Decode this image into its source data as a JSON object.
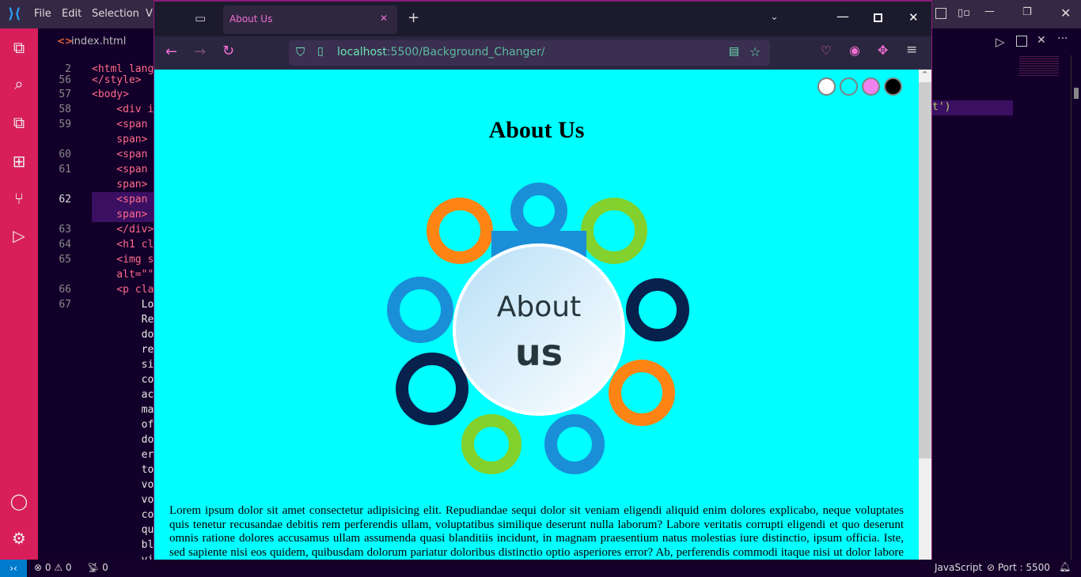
{
  "vscode": {
    "menu": [
      "File",
      "Edit",
      "Selection",
      "V"
    ],
    "tab": "index.html",
    "code_lines": [
      {
        "n": "2",
        "t": "<html lang"
      },
      {
        "n": "56",
        "t": "</style>"
      },
      {
        "n": "57",
        "t": "<body>"
      },
      {
        "n": "58",
        "t": "    <div i"
      },
      {
        "n": "59",
        "t": "    <span "
      },
      {
        "n": "",
        "t": "    span>"
      },
      {
        "n": "60",
        "t": "    <span "
      },
      {
        "n": "61",
        "t": "    <span "
      },
      {
        "n": "",
        "t": "    span>"
      },
      {
        "n": "62",
        "t": "    <span "
      },
      {
        "n": "",
        "t": "    span>"
      },
      {
        "n": "63",
        "t": "    </div>"
      },
      {
        "n": "64",
        "t": "    <h1 cl"
      },
      {
        "n": "65",
        "t": "    <img s"
      },
      {
        "n": "",
        "t": "    alt=\"\""
      },
      {
        "n": "66",
        "t": "    <p cla"
      },
      {
        "n": "67",
        "t": "        Lo"
      },
      {
        "n": "",
        "t": "        Re"
      },
      {
        "n": "",
        "t": "        do"
      },
      {
        "n": "",
        "t": "        re"
      },
      {
        "n": "",
        "t": "        si"
      },
      {
        "n": "",
        "t": "        co"
      },
      {
        "n": "",
        "t": "        ac"
      },
      {
        "n": "",
        "t": "        ma"
      },
      {
        "n": "",
        "t": "        of"
      },
      {
        "n": "",
        "t": "        do"
      },
      {
        "n": "",
        "t": "        er"
      },
      {
        "n": "",
        "t": "        to"
      },
      {
        "n": "",
        "t": "        vo"
      },
      {
        "n": "",
        "t": "        vo"
      },
      {
        "n": "",
        "t": "        co"
      },
      {
        "n": "",
        "t": "        qu"
      },
      {
        "n": "",
        "t": "        bl"
      },
      {
        "n": "",
        "t": "        vi"
      }
    ],
    "right_code": "t')",
    "status": {
      "errors": "0",
      "warnings": "0",
      "ports": "0",
      "language": "JavaScript",
      "port": "Port : 5500"
    }
  },
  "browser": {
    "tab_title": "About Us",
    "url_host": "localhost",
    "url_path": ":5500/Background_Changer/",
    "page": {
      "color_options": [
        "#ffffff",
        "#00ffff",
        "#ee82ee",
        "#000000"
      ],
      "heading": "About Us",
      "image_text": [
        "About",
        "us"
      ],
      "paragraph": "Lorem ipsum dolor sit amet consectetur adipisicing elit. Repudiandae sequi dolor sit veniam eligendi aliquid enim dolores explicabo, neque voluptates quis tenetur recusandae debitis rem perferendis ullam, voluptatibus similique deserunt nulla laborum? Labore veritatis corrupti eligendi et quo deserunt omnis ratione dolores accusamus ullam assumenda quasi blanditiis incidunt, in magnam praesentium natus molestias iure distinctio, ipsum officia. Iste, sed sapiente nisi eos quidem, quibusdam dolorum pariatur doloribus distinctio optio asperiores error? Ab, perferendis commodi itaque nisi ut dolor labore totam delectus, culpa ratione quo sapiente magnam nobis voluptas vitae consectetur sunt"
    }
  }
}
